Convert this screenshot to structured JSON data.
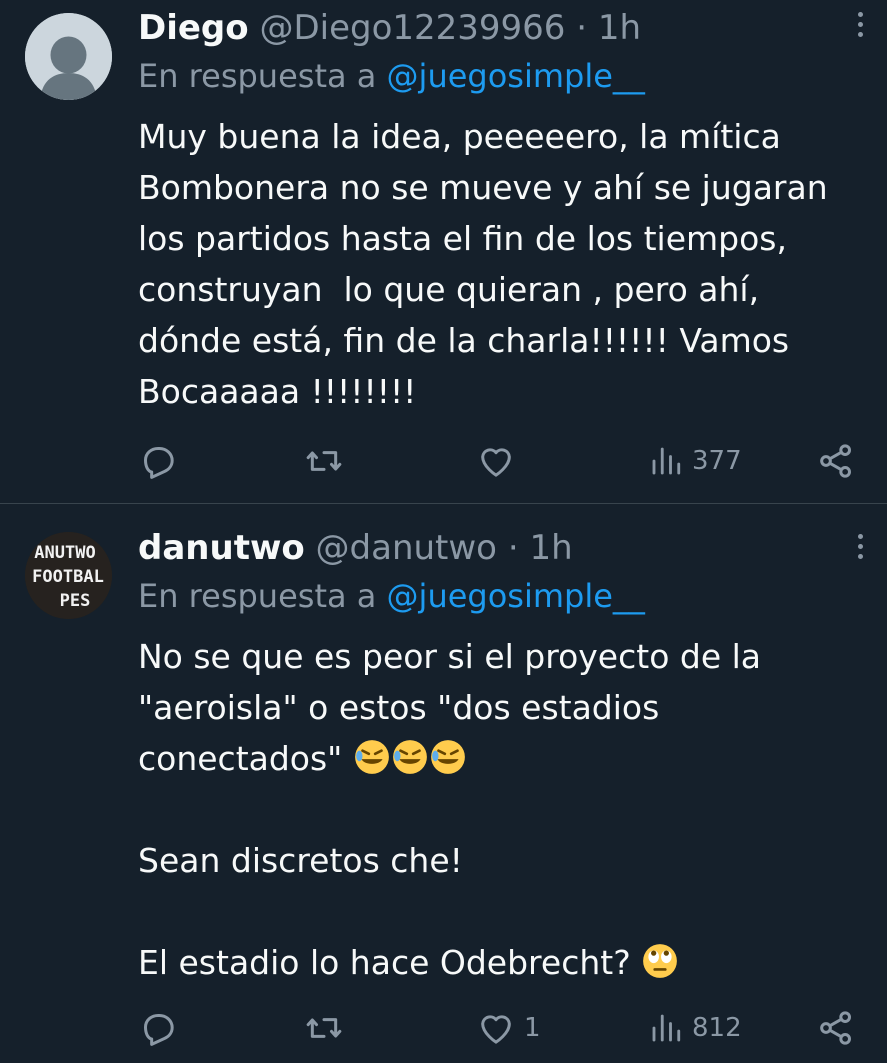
{
  "tweets": [
    {
      "name": "Diego",
      "handle": "@Diego12239966",
      "separator": "·",
      "time": "1h",
      "reply_prefix": "En respuesta a",
      "reply_mention": "@juegosimple__",
      "text": "Muy buena la idea, peeeeero, la mítica\nBombonera no se mueve y ahí se jugaran\nlos partidos hasta el fin de los tiempos,\nconstruyan  lo que quieran , pero ahí,\ndónde está, fin de la charla!!!!!! Vamos\nBocaaaaa !!!!!!!!",
      "likes": "",
      "views": "377"
    },
    {
      "name": "danutwo",
      "handle": "@danutwo",
      "separator": "·",
      "time": "1h",
      "avatar_text": [
        "ANUTWO",
        "FOOTBAL",
        "PES"
      ],
      "reply_prefix": "En respuesta a",
      "reply_mention": "@juegosimple__",
      "text_part1": "No se que es peor si el proyecto de la\n\"aeroisla\" o estos \"dos estadios\nconectados\" ",
      "text_part2": "\n\nSean discretos che!\n\nEl estadio lo hace Odebrecht? ",
      "likes": "1",
      "views": "812"
    }
  ],
  "icons": [
    "reply-icon",
    "retweet-icon",
    "like-icon",
    "views-icon",
    "share-icon",
    "more-icon",
    "rofl-emoji",
    "eye-roll-emoji"
  ]
}
